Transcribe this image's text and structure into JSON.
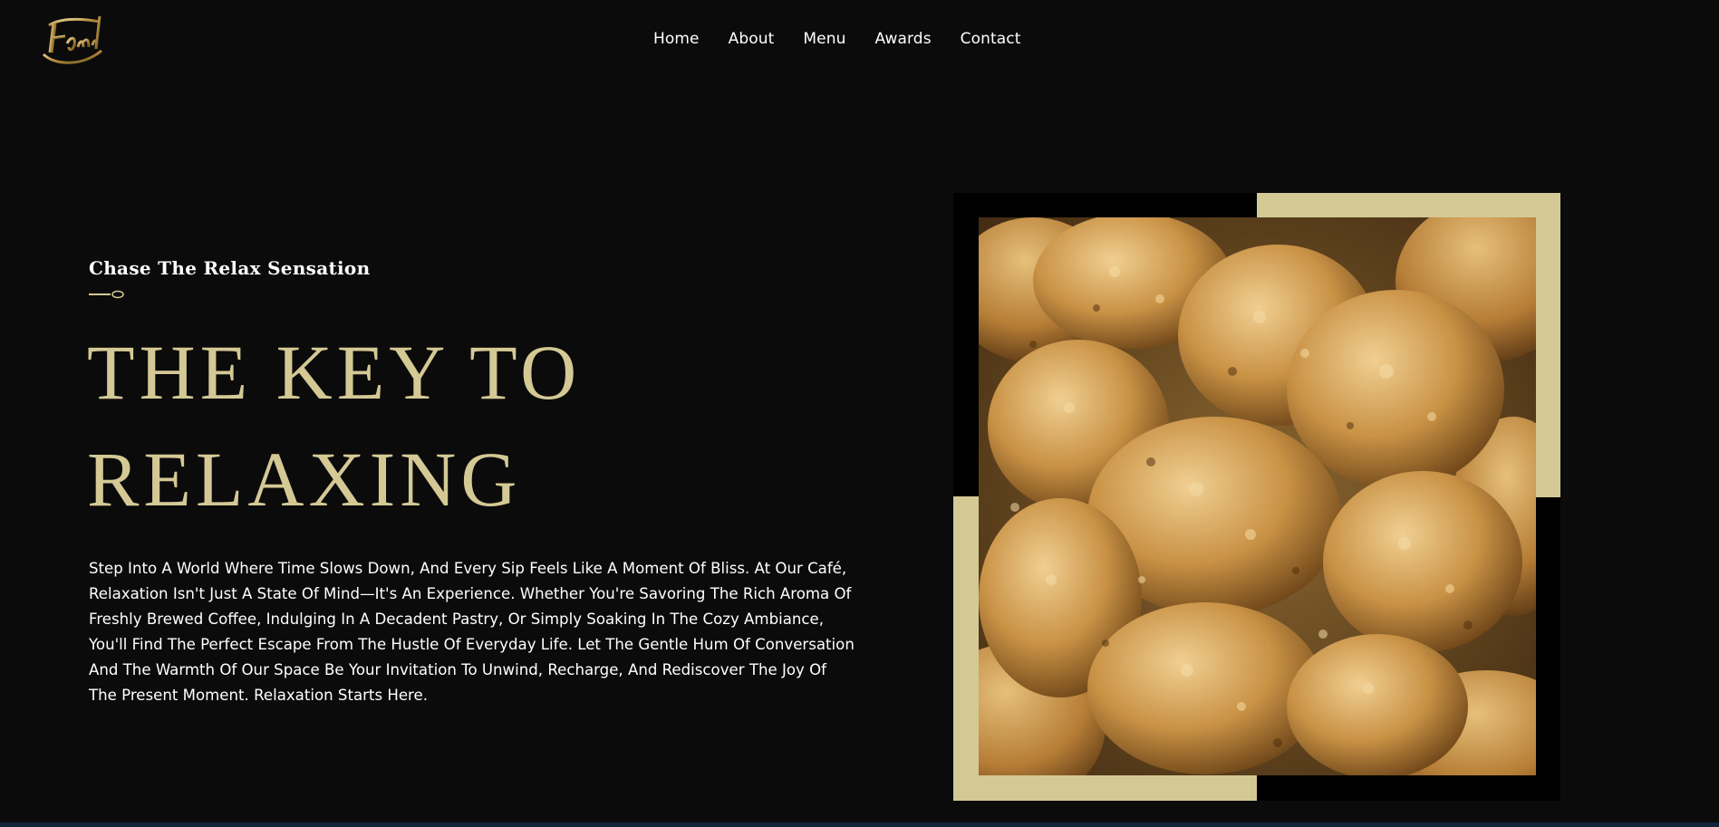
{
  "brand": {
    "logo_text": "Fennel",
    "accent_color": "#d4c995",
    "background_color": "#0b0b0b"
  },
  "nav": {
    "items": [
      {
        "label": "Home"
      },
      {
        "label": "About"
      },
      {
        "label": "Menu"
      },
      {
        "label": "Awards"
      },
      {
        "label": "Contact"
      }
    ]
  },
  "hero": {
    "subtitle": "Chase The Relax Sensation",
    "divider_icon": "spoon-divider-icon",
    "headline_line1": "THE KEY TO",
    "headline_line2": "RELAXING",
    "body": "Step Into A World Where Time Slows Down, And Every Sip Feels Like A Moment Of Bliss. At Our Café, Relaxation Isn't Just A State Of Mind—It's An Experience. Whether You're Savoring The Rich Aroma Of Freshly Brewed Coffee, Indulging In A Decadent Pastry, Or Simply Soaking In The Cozy Ambiance, You'll Find The Perfect Escape From The Hustle Of Everyday Life. Let The Gentle Hum Of Conversation And The Warmth Of Our Space Be Your Invitation To Unwind, Recharge, And Rediscover The Joy Of The Present Moment. Relaxation Starts Here."
  },
  "image": {
    "subject": "fried-chicken-photo"
  }
}
